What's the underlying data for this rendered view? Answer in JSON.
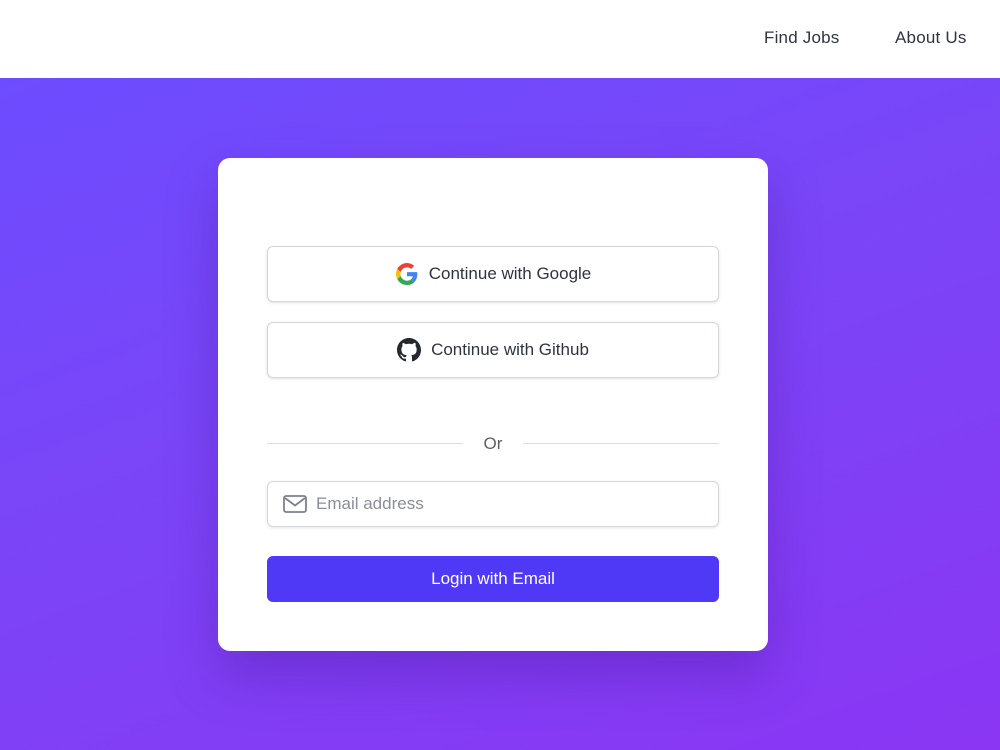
{
  "nav": {
    "find_jobs": "Find Jobs",
    "about_us": "About Us"
  },
  "login_card": {
    "google_button": {
      "label": "Continue with Google",
      "icon": "google-icon"
    },
    "github_button": {
      "label": "Continue with Github",
      "icon": "github-icon"
    },
    "divider_text": "Or",
    "email_field": {
      "placeholder": "Email address",
      "value": "",
      "icon": "mail-icon"
    },
    "login_button": {
      "label": "Login with Email"
    }
  },
  "colors": {
    "primary_button": "#4f39f6",
    "hero_gradient_start": "#6d4cff",
    "hero_gradient_end": "#8a36f3",
    "text_dark": "#2f3441"
  }
}
